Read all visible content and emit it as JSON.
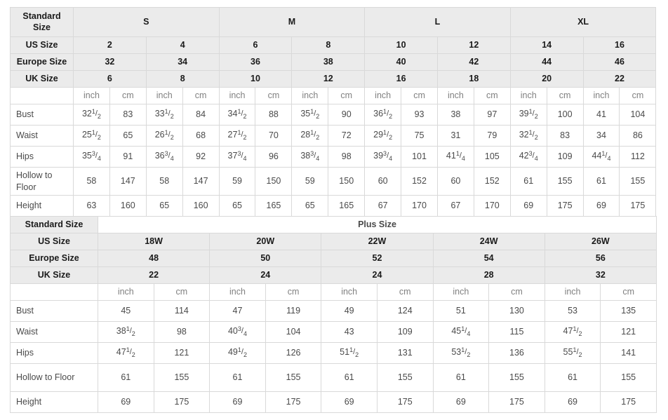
{
  "standard": {
    "label_standard_size": "Standard Size",
    "label_us_size": "US Size",
    "label_europe_size": "Europe Size",
    "label_uk_size": "UK Size",
    "unit_inch": "inch",
    "unit_cm": "cm",
    "groups": [
      "S",
      "M",
      "L",
      "XL"
    ],
    "us_size": [
      "2",
      "4",
      "6",
      "8",
      "10",
      "12",
      "14",
      "16"
    ],
    "europe_size": [
      "32",
      "34",
      "36",
      "38",
      "40",
      "42",
      "44",
      "46"
    ],
    "uk_size": [
      "6",
      "8",
      "10",
      "12",
      "16",
      "18",
      "20",
      "22"
    ],
    "measure_rows": [
      {
        "label": "Bust",
        "inch": [
          "32 1/2",
          "33 1/2",
          "34 1/2",
          "35 1/2",
          "36 1/2",
          "38",
          "39 1/2",
          "41"
        ],
        "cm": [
          "83",
          "84",
          "88",
          "90",
          "93",
          "97",
          "100",
          "104"
        ]
      },
      {
        "label": "Waist",
        "inch": [
          "25 1/2",
          "26 1/2",
          "27 1/2",
          "28 1/2",
          "29 1/2",
          "31",
          "32 1/2",
          "34"
        ],
        "cm": [
          "65",
          "68",
          "70",
          "72",
          "75",
          "79",
          "83",
          "86"
        ]
      },
      {
        "label": "Hips",
        "inch": [
          "35 3/4",
          "36 3/4",
          "37 3/4",
          "38 3/4",
          "39 3/4",
          "41 1/4",
          "42 3/4",
          "44 1/4"
        ],
        "cm": [
          "91",
          "92",
          "96",
          "98",
          "101",
          "105",
          "109",
          "112"
        ]
      },
      {
        "label": "Hollow to Floor",
        "inch": [
          "58",
          "58",
          "59",
          "59",
          "60",
          "60",
          "61",
          "61"
        ],
        "cm": [
          "147",
          "147",
          "150",
          "150",
          "152",
          "152",
          "155",
          "155"
        ]
      },
      {
        "label": "Height",
        "inch": [
          "63",
          "65",
          "65",
          "65",
          "67",
          "67",
          "69",
          "69"
        ],
        "cm": [
          "160",
          "160",
          "165",
          "165",
          "170",
          "170",
          "175",
          "175"
        ]
      }
    ]
  },
  "plus": {
    "label_standard_size": "Standard Size",
    "plus_title": "Plus Size",
    "label_us_size": "US Size",
    "label_europe_size": "Europe Size",
    "label_uk_size": "UK Size",
    "unit_inch": "inch",
    "unit_cm": "cm",
    "us_size": [
      "18W",
      "20W",
      "22W",
      "24W",
      "26W"
    ],
    "europe_size": [
      "48",
      "50",
      "52",
      "54",
      "56"
    ],
    "uk_size": [
      "22",
      "24",
      "24",
      "28",
      "32"
    ],
    "measure_rows": [
      {
        "label": "Bust",
        "inch": [
          "45",
          "47",
          "49",
          "51",
          "53"
        ],
        "cm": [
          "114",
          "119",
          "124",
          "130",
          "135"
        ]
      },
      {
        "label": "Waist",
        "inch": [
          "38 1/2",
          "40 3/4",
          "43",
          "45 1/4",
          "47 1/2"
        ],
        "cm": [
          "98",
          "104",
          "109",
          "115",
          "121"
        ]
      },
      {
        "label": "Hips",
        "inch": [
          "47 1/2",
          "49 1/2",
          "51 1/2",
          "53 1/2",
          "55 1/2"
        ],
        "cm": [
          "121",
          "126",
          "131",
          "136",
          "141"
        ]
      },
      {
        "label": "Hollow to Floor",
        "inch": [
          "61",
          "61",
          "61",
          "61",
          "61"
        ],
        "cm": [
          "155",
          "155",
          "155",
          "155",
          "155"
        ]
      },
      {
        "label": "Height",
        "inch": [
          "69",
          "69",
          "69",
          "69",
          "69"
        ],
        "cm": [
          "175",
          "175",
          "175",
          "175",
          "175"
        ]
      }
    ]
  },
  "colors": {
    "header_bg": "#ebebeb",
    "border": "#d9d9d9",
    "text": "#4a4a4a",
    "header_text": "#1a1a1a"
  }
}
